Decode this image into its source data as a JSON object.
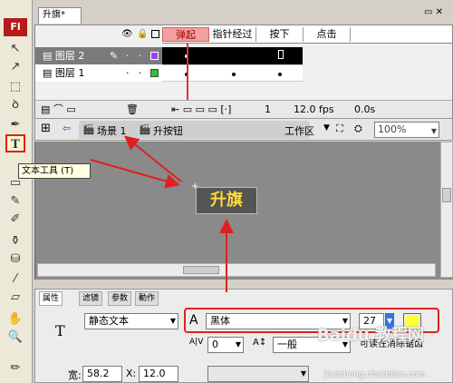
{
  "app": {
    "logo": "Fl",
    "document_tab": "升旗*"
  },
  "toolbar": {
    "tool_icons": [
      "arrow-icon",
      "subselect-icon",
      "free-transform-icon",
      "lasso-icon",
      "pen-icon",
      "text-icon",
      "line-icon",
      "rect-icon",
      "pencil-icon",
      "brush-icon",
      "ink-bottle-icon",
      "paint-bucket-icon",
      "eyedropper-icon",
      "eraser-icon",
      "hand-icon",
      "zoom-icon",
      "stroke-color-icon"
    ],
    "text_tool_glyph": "T"
  },
  "tooltip": {
    "text": "文本工具 (T)"
  },
  "timeline": {
    "frames": [
      "弹起",
      "指针经过",
      "按下",
      "点击"
    ],
    "layers": [
      {
        "name": "图层 2",
        "selected": true
      },
      {
        "name": "图层 1",
        "selected": false
      }
    ],
    "status": {
      "frame": "1",
      "fps": "12.0 fps",
      "time": "0.0s"
    }
  },
  "editbar": {
    "scene": "场景 1",
    "symbol": "升按钮",
    "workspace": "工作区",
    "zoom": "100%"
  },
  "stage": {
    "button_text": "升旗"
  },
  "properties": {
    "tabs": [
      "属性",
      "滤镜",
      "参数",
      "動作"
    ],
    "text_type": "静态文本",
    "font_icon": "A",
    "font_name": "黑体",
    "font_size": "27",
    "letter_spacing": "0",
    "char_position": "一般",
    "auto_kern_label": "可读性消除锯齿",
    "width_label": "宽:",
    "width_value": "58.2",
    "x_label": "X:",
    "x_value": "12.0",
    "type_glyph": "T",
    "text_color": "#ffff33"
  },
  "watermark": {
    "text": "Baidu 教程网",
    "sub": "jiaocheng.chazidian.com"
  }
}
